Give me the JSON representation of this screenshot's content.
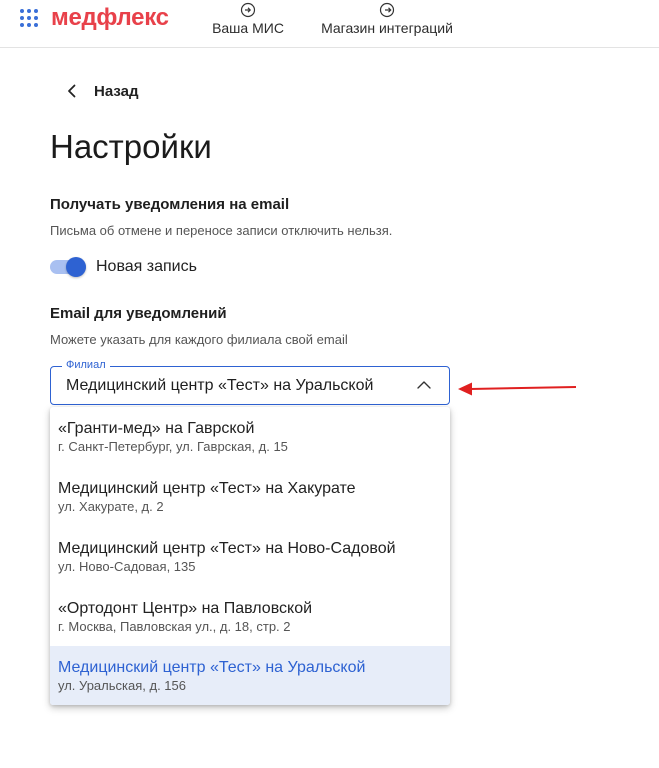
{
  "header": {
    "logo": "медфлекс",
    "nav": [
      {
        "label": "Ваша МИС",
        "icon": "login-icon"
      },
      {
        "label": "Магазин интеграций",
        "icon": "logout-icon"
      }
    ]
  },
  "back_label": "Назад",
  "page_title": "Настройки",
  "notifications": {
    "title": "Получать уведомления на email",
    "description": "Письма об отмене и переносе записи отключить нельзя.",
    "toggle_label": "Новая запись",
    "toggle_on": true
  },
  "email": {
    "title": "Email для уведомлений",
    "description": "Можете указать для каждого филиала свой email"
  },
  "branch_select": {
    "label": "Филиал",
    "value": "Медицинский центр «Тест» на Уральской",
    "options": [
      {
        "name": "«Гранти-мед» на Гаврской",
        "address": "г. Санкт-Петербург, ул. Гаврская, д. 15"
      },
      {
        "name": "Медицинский центр «Тест» на Хакурате",
        "address": "ул. Хакурате, д. 2"
      },
      {
        "name": "Медицинский центр «Тест» на Ново-Садовой",
        "address": "ул. Ново-Садовая, 135"
      },
      {
        "name": "«Ортодонт Центр» на Павловской",
        "address": "г. Москва, Павловская ул., д. 18, стр. 2"
      },
      {
        "name": "Медицинский центр «Тест» на Уральской",
        "address": "ул. Уральская, д. 156",
        "selected": true
      }
    ]
  },
  "colors": {
    "brand": "#e8414a",
    "accent": "#2e62d2",
    "selected_bg": "#e7edf9",
    "annotation_arrow": "#e02020"
  }
}
